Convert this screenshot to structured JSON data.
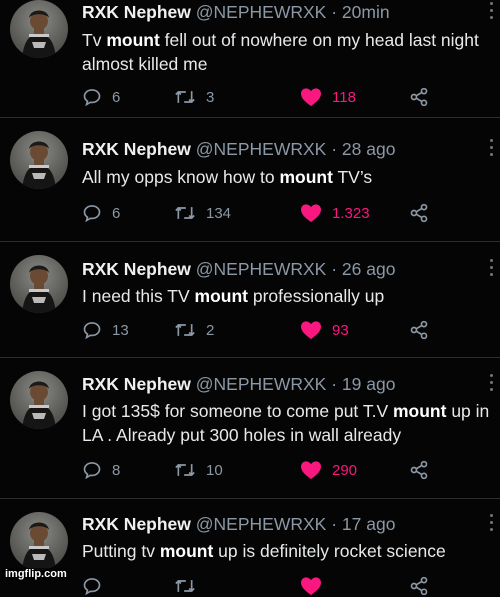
{
  "tweets": [
    {
      "name": "RXK Nephew",
      "handle": "@NEPHEWRXK",
      "sep": " · ",
      "time": "20min",
      "text_parts": [
        "Tv ",
        "mount",
        " fell out of nowhere on my head last night almost killed me"
      ],
      "replies": "6",
      "retweets": "3",
      "likes": "118"
    },
    {
      "name": "RXK Nephew",
      "handle": "@NEPHEWRXK",
      "sep": " · ",
      "time": "28 ago",
      "text_parts": [
        "All my opps know how to ",
        "mount",
        " TV’s"
      ],
      "replies": "6",
      "retweets": "134",
      "likes": "1.323"
    },
    {
      "name": "RXK Nephew",
      "handle": "@NEPHEWRXK",
      "sep": " · ",
      "time": "26 ago",
      "text_parts": [
        "I need this TV ",
        "mount",
        " professionally up"
      ],
      "replies": "13",
      "retweets": "2",
      "likes": "93"
    },
    {
      "name": "RXK Nephew",
      "handle": "@NEPHEWRXK",
      "sep": " · ",
      "time": "19 ago",
      "text_parts": [
        "I got 135$ for someone to come put T.V ",
        "mount",
        " up in LA . Already put 300 holes in wall already"
      ],
      "replies": "8",
      "retweets": "10",
      "likes": "290"
    },
    {
      "name": "RXK Nephew",
      "handle": "@NEPHEWRXK",
      "sep": " · ",
      "time": "17 ago",
      "text_parts": [
        "Putting tv ",
        "mount",
        " up is definitely rocket science"
      ],
      "replies": "",
      "retweets": "",
      "likes": ""
    }
  ],
  "icons": {
    "reply": "reply-icon",
    "retweet": "retweet-icon",
    "like": "heart-icon",
    "share": "share-icon",
    "more": "more-icon"
  },
  "colors": {
    "background": "#050505",
    "like_active": "#f91880",
    "muted": "#8b98a5"
  },
  "watermark": "imgflip.com"
}
